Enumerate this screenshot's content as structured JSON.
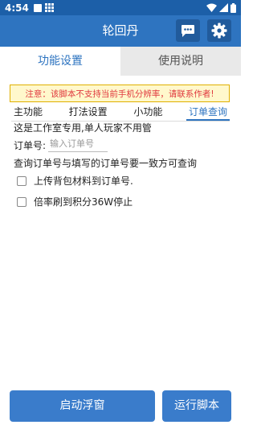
{
  "status_bar": {
    "time": "4:54",
    "icons": [
      "notification-square-icon",
      "grid-icon",
      "wifi-icon",
      "signal-icon",
      "battery-icon"
    ]
  },
  "app_bar": {
    "title": "轮回丹",
    "buttons": [
      "chat-icon",
      "gear-icon"
    ]
  },
  "top_tabs": [
    {
      "label": "功能设置",
      "active": true
    },
    {
      "label": "使用说明",
      "active": false
    }
  ],
  "notice": "注意：该脚本不支持当前手机分辨率，请联系作者!",
  "sub_tabs": [
    {
      "label": "主功能",
      "active": false
    },
    {
      "label": "打法设置",
      "active": false
    },
    {
      "label": "小功能",
      "active": false
    },
    {
      "label": "订单查询",
      "active": true
    }
  ],
  "content": {
    "studio_note": "这是工作室专用,单人玩家不用管",
    "order_label": "订单号:",
    "order_placeholder": "输入订单号",
    "order_value": "",
    "query_note": "查询订单号与填写的订单号要一致方可查询",
    "options": [
      {
        "label": "上传背包材料到订单号.",
        "checked": false
      },
      {
        "label": "倍率刷到积分36W停止",
        "checked": false
      }
    ]
  },
  "bottom_buttons": {
    "float_label": "启动浮窗",
    "run_label": "运行脚本"
  },
  "colors": {
    "status_bar": "#1c5fa8",
    "app_bar": "#2e74c0",
    "accent": "#2e74c0",
    "notice_text": "#e0383e",
    "notice_border": "#e0b000",
    "button": "#3a7ccb"
  }
}
